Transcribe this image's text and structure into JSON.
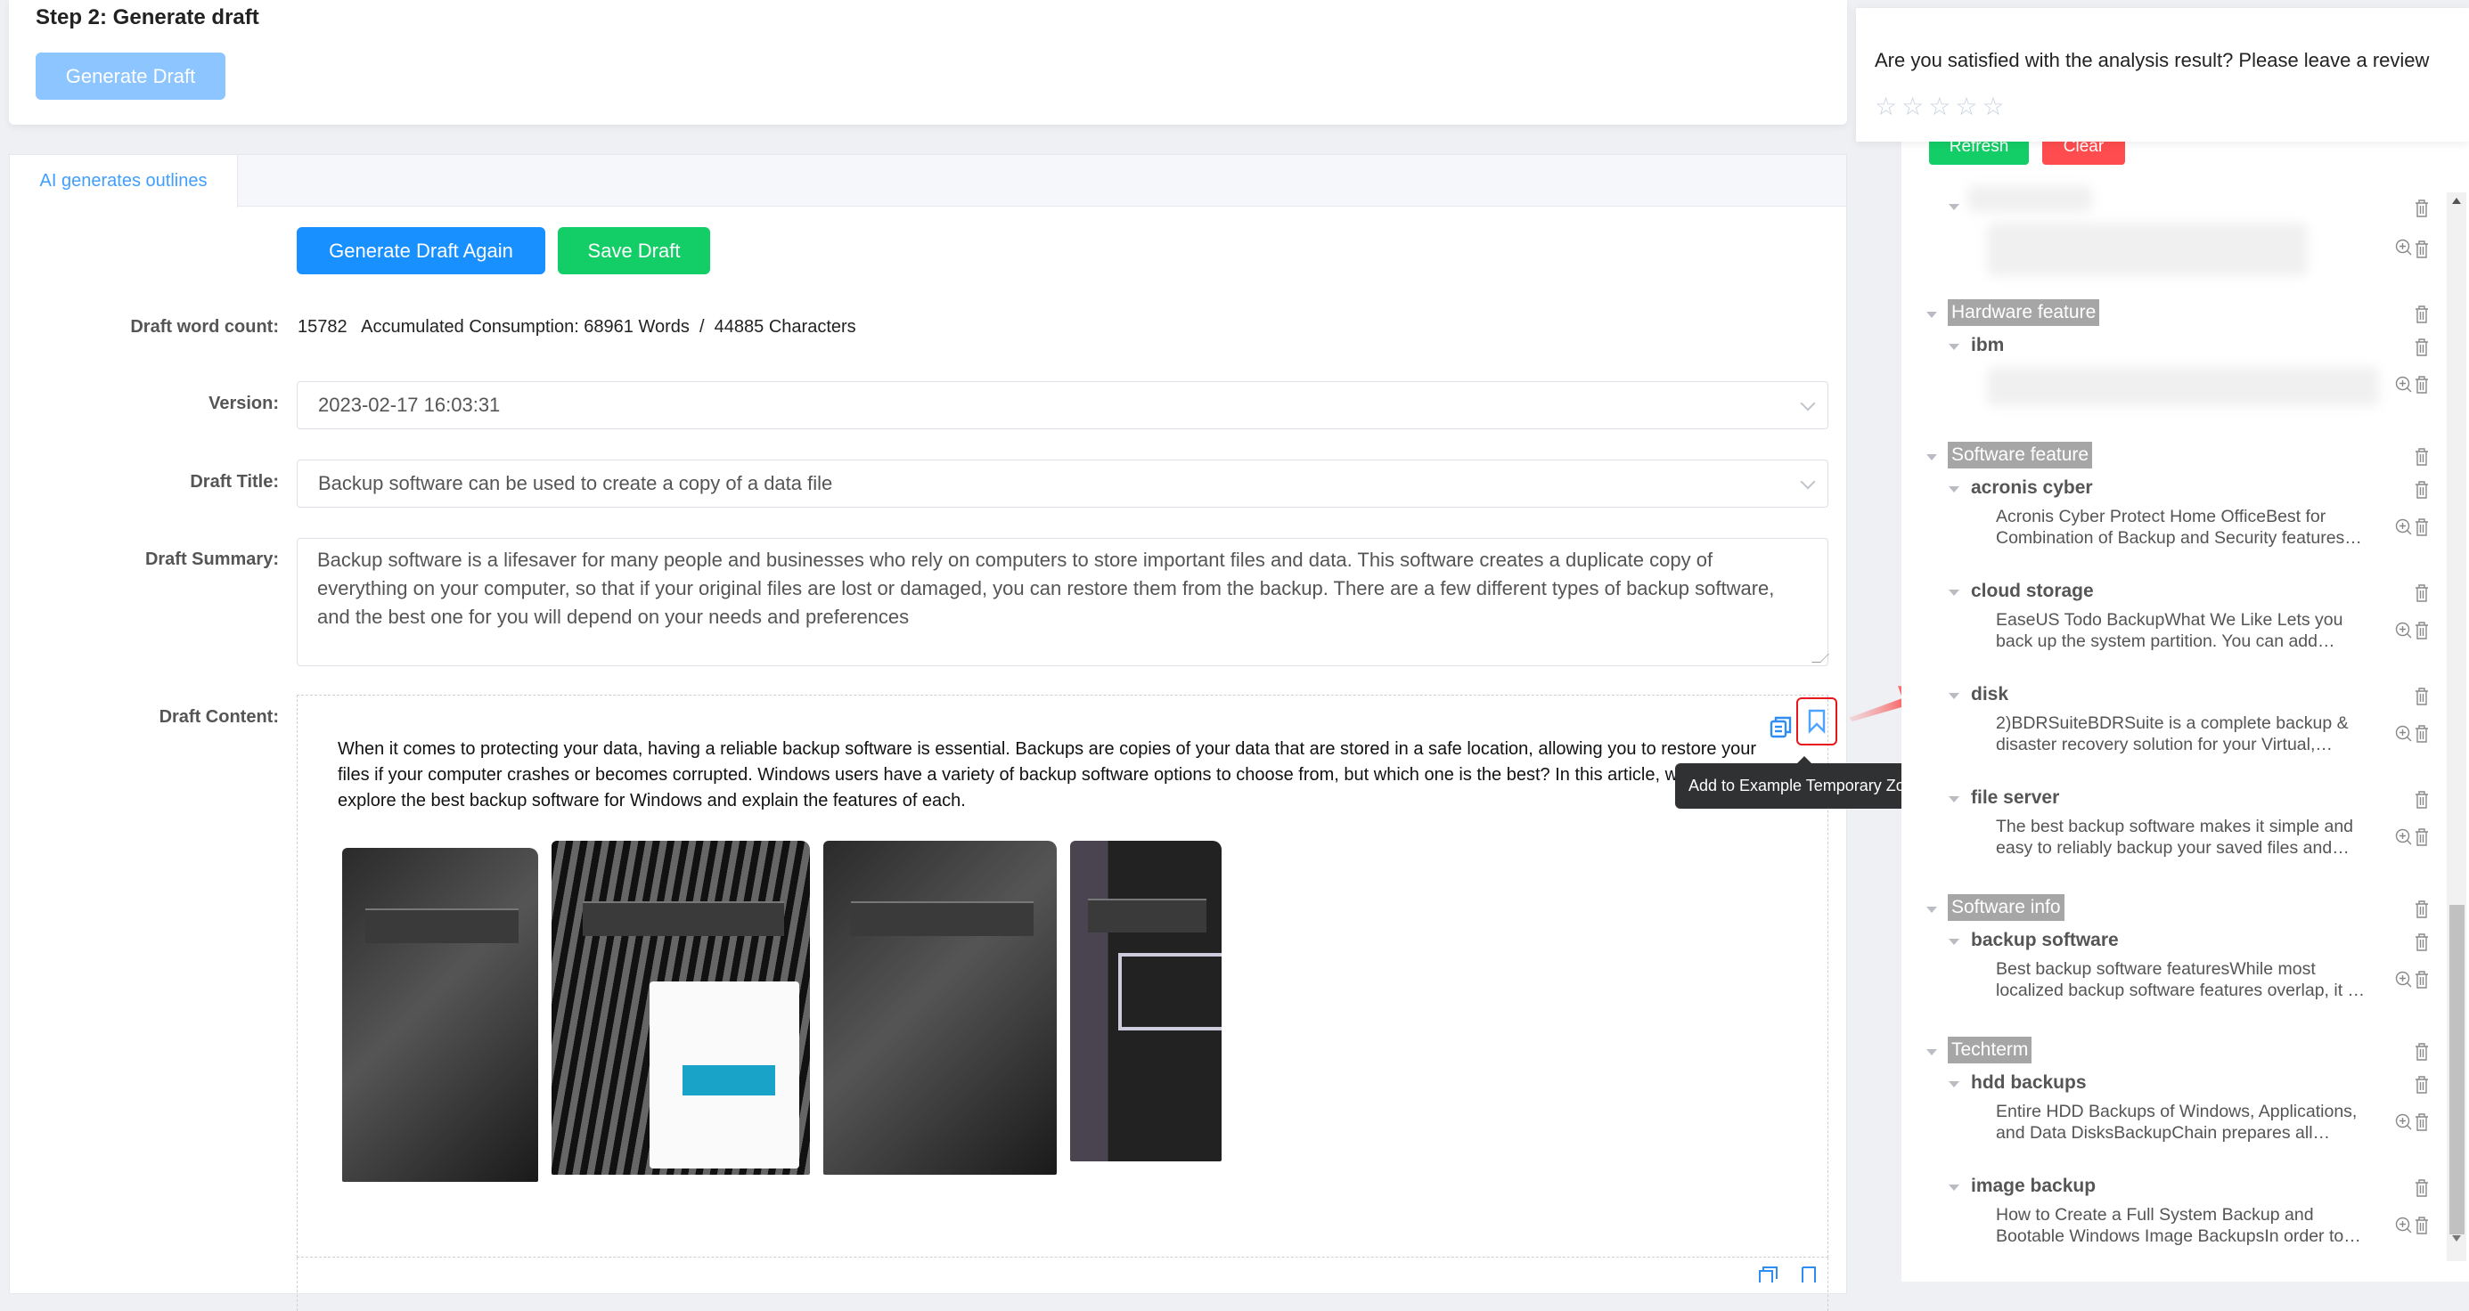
{
  "step": {
    "title": "Step 2: Generate draft",
    "generate_button": "Generate Draft"
  },
  "tabs": [
    {
      "label": "AI generates outlines",
      "active": true
    }
  ],
  "actions": {
    "generate_again": "Generate Draft Again",
    "save_draft": "Save Draft"
  },
  "form": {
    "word_count_label": "Draft word count:",
    "word_count_value": "15782   Accumulated Consumption: 68961 Words  /  44885 Characters",
    "version_label": "Version:",
    "version_value": "2023-02-17 16:03:31",
    "title_label": "Draft Title:",
    "title_value": "Backup software can be used to create a copy of a data file",
    "summary_label": "Draft Summary:",
    "summary_value": "Backup software is a lifesaver for many people and businesses who rely on computers to store important files and data. This software creates a duplicate copy of everything on your computer, so that if your original files are lost or damaged, you can restore them from the backup. There are a few different types of backup software, and the best one for you will depend on your needs and preferences",
    "content_label": "Draft Content:",
    "content_text": "When it comes to protecting your data, having a reliable backup software is essential. Backups are copies of your data that are stored in a safe location, allowing you to restore your files if your computer crashes or becomes corrupted. Windows users have a variety of backup software options to choose from, but which one is the best? In this article, we will explore the best backup software for Windows and explain the features of each."
  },
  "tooltip": "Add to Example Temporary Zone",
  "review": {
    "question": "Are you satisfied with the analysis result? Please leave a review",
    "rating": 0,
    "max_rating": 5
  },
  "right_panel": {
    "refresh": "Refresh",
    "clear": "Clear",
    "categories": [
      {
        "name": "Hardware feature",
        "keywords": [
          {
            "name": "ibm",
            "snippet": [
              "",
              ""
            ]
          }
        ]
      },
      {
        "name": "Software feature",
        "keywords": [
          {
            "name": "acronis cyber",
            "snippet": [
              "Acronis Cyber Protect Home OfficeBest for",
              "Combination of Backup and Security features…"
            ]
          },
          {
            "name": "cloud storage",
            "snippet": [
              "EaseUS Todo BackupWhat We Like Lets you",
              "back up the system partition. You can add…"
            ]
          },
          {
            "name": "disk",
            "snippet": [
              "2)BDRSuiteBDRSuite is a complete backup &",
              "disaster recovery solution for your Virtual,…"
            ]
          },
          {
            "name": "file server",
            "snippet": [
              "The best backup software makes it simple and",
              "easy to reliably backup your saved files and…"
            ]
          }
        ]
      },
      {
        "name": "Software info",
        "keywords": [
          {
            "name": "backup software",
            "snippet": [
              "Best backup software featuresWhile most",
              "localized backup software features overlap, it …"
            ]
          }
        ]
      },
      {
        "name": "Techterm",
        "keywords": [
          {
            "name": "hdd backups",
            "snippet": [
              "Entire HDD Backups of Windows, Applications,",
              "and Data DisksBackupChain prepares all…"
            ]
          },
          {
            "name": "image backup",
            "snippet": [
              "How to Create a Full System Backup and",
              "Bootable Windows Image BackupsIn order to…"
            ]
          }
        ]
      }
    ]
  },
  "colors": {
    "primary": "#1890ff",
    "success": "#13ce66",
    "danger": "#ff4d4f",
    "disabled_primary": "#8cc5ff",
    "highlight_border": "#e8161c",
    "category_bg": "#a6a6a6"
  }
}
